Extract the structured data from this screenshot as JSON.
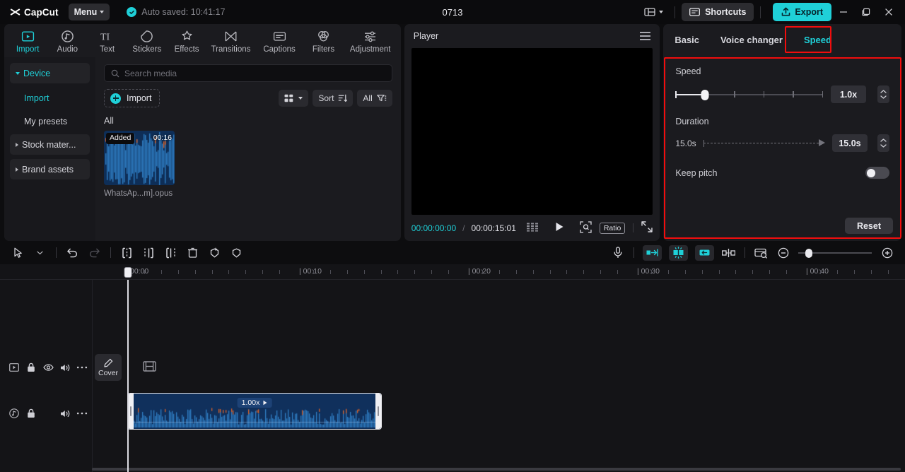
{
  "titlebar": {
    "app_name": "CapCut",
    "menu_label": "Menu",
    "autosave_text": "Auto saved: 10:41:17",
    "project_title": "0713",
    "shortcuts_label": "Shortcuts",
    "export_label": "Export",
    "accent_color": "#1fd0d8"
  },
  "function_tabs": [
    {
      "label": "Import",
      "icon": "import-icon",
      "active": true
    },
    {
      "label": "Audio",
      "icon": "audio-icon",
      "active": false
    },
    {
      "label": "Text",
      "icon": "text-icon",
      "active": false
    },
    {
      "label": "Stickers",
      "icon": "stickers-icon",
      "active": false
    },
    {
      "label": "Effects",
      "icon": "effects-icon",
      "active": false
    },
    {
      "label": "Transitions",
      "icon": "transitions-icon",
      "active": false
    },
    {
      "label": "Captions",
      "icon": "captions-icon",
      "active": false
    },
    {
      "label": "Filters",
      "icon": "filters-icon",
      "active": false
    },
    {
      "label": "Adjustment",
      "icon": "adjustment-icon",
      "active": false
    }
  ],
  "sidebar": {
    "items": [
      {
        "label": "Device",
        "type": "group",
        "expanded": true,
        "active": true
      },
      {
        "label": "Import",
        "type": "sub",
        "active": true
      },
      {
        "label": "My presets",
        "type": "sub",
        "active": false
      },
      {
        "label": "Stock mater...",
        "type": "group",
        "expanded": false,
        "active": false
      },
      {
        "label": "Brand assets",
        "type": "group",
        "expanded": false,
        "active": false
      }
    ]
  },
  "browser": {
    "search_placeholder": "Search media",
    "import_label": "Import",
    "sort_label": "Sort",
    "filter_label": "All",
    "section_label": "All",
    "media": [
      {
        "name": "WhatsAp...m].opus",
        "badge": "Added",
        "duration": "00:16",
        "type": "audio"
      }
    ]
  },
  "player": {
    "title": "Player",
    "current_time": "00:00:00:00",
    "separator": "/",
    "total_time": "00:00:15:01",
    "ratio_label": "Ratio"
  },
  "attributes": {
    "tabs": [
      {
        "label": "Basic",
        "active": false
      },
      {
        "label": "Voice changer",
        "active": false
      },
      {
        "label": "Speed",
        "active": true,
        "highlighted": true
      }
    ],
    "speed": {
      "label": "Speed",
      "value": "1.0x",
      "slider_percent": 20,
      "tick_percents": [
        40,
        60,
        80,
        100
      ]
    },
    "duration": {
      "label": "Duration",
      "left_value": "15.0s",
      "value": "15.0s"
    },
    "keep_pitch": {
      "label": "Keep pitch",
      "enabled": false
    },
    "reset_label": "Reset",
    "highlight_color": "#f20d0d"
  },
  "timeline": {
    "tools_left": [
      "cursor-icon",
      "chevron-down-icon",
      "undo-icon",
      "redo-icon",
      "split-icon",
      "split-left-icon",
      "split-right-icon",
      "delete-icon",
      "keyframe-add-icon",
      "keyframe-icon"
    ],
    "tools_right": [
      "microphone-icon",
      "snap-start-icon",
      "snap-center-icon",
      "snap-end-icon",
      "mirror-split-icon",
      "preview-icon",
      "zoom-out-icon",
      "zoom-in-icon"
    ],
    "ruler_labels": [
      "00:00",
      "00:10",
      "00:20",
      "00:30",
      "00:40"
    ],
    "playhead_time": "00:00",
    "video_track": {
      "controls": [
        "play-icon",
        "lock-icon",
        "eye-icon",
        "volume-icon",
        "more-icon"
      ],
      "cover_label": "Cover"
    },
    "audio_track": {
      "controls": [
        "audio-icon",
        "lock-icon",
        "volume-icon",
        "more-icon"
      ],
      "clip": {
        "speed_label": "1.00x",
        "selected": true
      }
    }
  }
}
